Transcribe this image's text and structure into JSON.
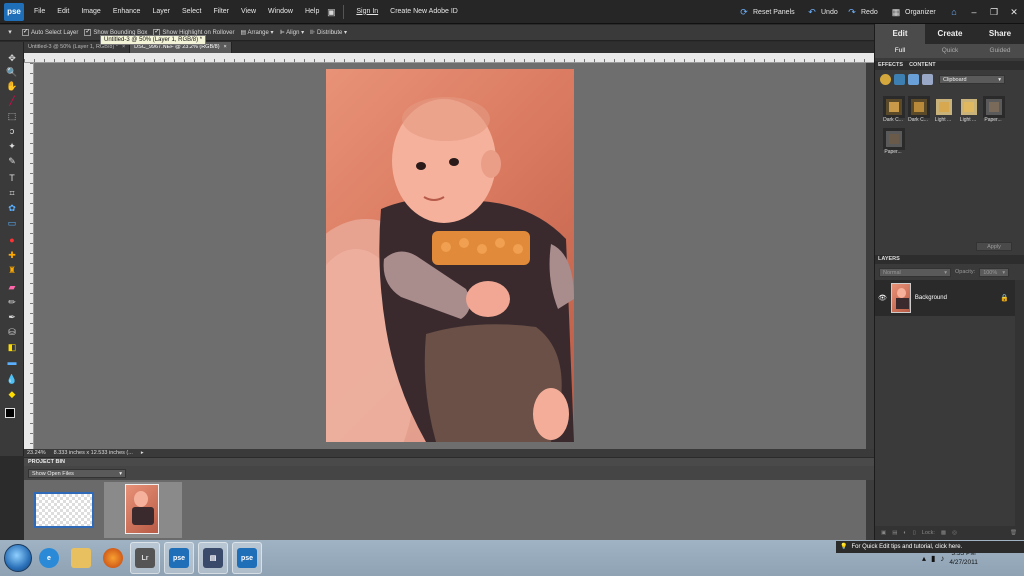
{
  "app": {
    "logo": "pse"
  },
  "menubar": {
    "items": [
      "File",
      "Edit",
      "Image",
      "Enhance",
      "Layer",
      "Select",
      "Filter",
      "View",
      "Window",
      "Help"
    ],
    "sign_in": "Sign In",
    "create_id": "Create New Adobe ID",
    "reset_panels": "Reset Panels",
    "undo": "Undo",
    "redo": "Redo",
    "organizer": "Organizer"
  },
  "options": {
    "auto_select": "Auto Select Layer",
    "show_bounding": "Show Bounding Box",
    "show_highlight": "Show Highlight on Rollover",
    "arrange": "Arrange",
    "align": "Align",
    "distribute": "Distribute"
  },
  "tooltip": "Untitled-3 @ 50% (Layer 1, RGB/8) *",
  "tabs": [
    {
      "label": "Untitled-3 @ 50% (Layer 1, RGB/8) *",
      "close": "×"
    },
    {
      "label": "DSC_9967.NEF @ 23.2% (RGB/8)",
      "close": "×"
    }
  ],
  "status": {
    "zoom": "23.24%",
    "size": "8.333 inches x 12.533 inches (..."
  },
  "project_bin": {
    "title": "PROJECT BIN",
    "show": "Show Open Files"
  },
  "panel": {
    "modes": [
      "Edit",
      "Create",
      "Share"
    ],
    "submodes": [
      "Full",
      "Quick",
      "Guided"
    ],
    "effects_tab": "EFFECTS",
    "content_tab": "CONTENT",
    "category": "Clipboard",
    "swatches": [
      "Dark C...",
      "Dark C...",
      "Light ...",
      "Light ...",
      "Paper...",
      "Paper..."
    ],
    "apply": "Apply",
    "layers_title": "LAYERS",
    "blend_mode": "Normal",
    "opacity_label": "Opacity:",
    "opacity_value": "100%",
    "layer_name": "Background",
    "lock_label": "Lock:"
  },
  "taskbar": {
    "apps": [
      "ie",
      "explorer",
      "firefox",
      "Lr",
      "pse",
      "video",
      "pse"
    ],
    "tip": "For Quick Edit tips and tutorial, click here.",
    "time": "3:35 PM",
    "date": "4/27/2011"
  },
  "colors": {
    "accent": "#1f6fb8",
    "panel": "#3a3a3a",
    "canvas": "#6e6e6e",
    "photo_tint": "#d9795f"
  }
}
